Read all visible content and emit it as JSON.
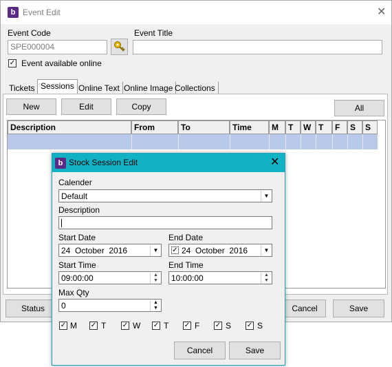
{
  "main_window": {
    "title": "Event Edit",
    "app_icon": "b",
    "event_code_label": "Event Code",
    "event_code_value": "SPE000004",
    "event_title_label": "Event Title",
    "event_title_value": "",
    "online_checkbox_label": "Event available online",
    "online_checked": true,
    "tabs": [
      "Tickets",
      "Sessions",
      "Online Text",
      "Online Image",
      "Collections"
    ],
    "active_tab": "Sessions",
    "buttons": {
      "new": "New",
      "edit": "Edit",
      "copy": "Copy",
      "all": "All"
    },
    "grid_columns": [
      "Description",
      "From",
      "To",
      "Time",
      "M",
      "T",
      "W",
      "T",
      "F",
      "S",
      "S"
    ],
    "footer_buttons": {
      "status": "Status",
      "cancel": "Cancel",
      "save": "Save"
    }
  },
  "dialog": {
    "title": "Stock Session Edit",
    "app_icon": "b",
    "calender_label": "Calender",
    "calender_value": "Default",
    "description_label": "Description",
    "description_value": "",
    "start_date_label": "Start Date",
    "start_date_value": "24  October  2016",
    "end_date_label": "End Date",
    "end_date_value": "24  October  2016",
    "end_date_checked": true,
    "start_time_label": "Start Time",
    "start_time_value": "09:00:00",
    "end_time_label": "End Time",
    "end_time_value": "10:00:00",
    "max_qty_label": "Max Qty",
    "max_qty_value": "0",
    "days": [
      {
        "label": "M",
        "checked": true
      },
      {
        "label": "T",
        "checked": true
      },
      {
        "label": "W",
        "checked": true
      },
      {
        "label": "T",
        "checked": true
      },
      {
        "label": "F",
        "checked": true
      },
      {
        "label": "S",
        "checked": true
      },
      {
        "label": "S",
        "checked": true
      }
    ],
    "cancel_label": "Cancel",
    "save_label": "Save"
  },
  "colors": {
    "dialog_titlebar": "#12b1c4",
    "selected_row": "#b8c9ea",
    "app_icon": "#5b2a86"
  },
  "icons": [
    "app-icon",
    "close-icon",
    "key-icon",
    "dropdown-arrow-icon",
    "spin-arrows-icon",
    "checkmark-icon"
  ]
}
